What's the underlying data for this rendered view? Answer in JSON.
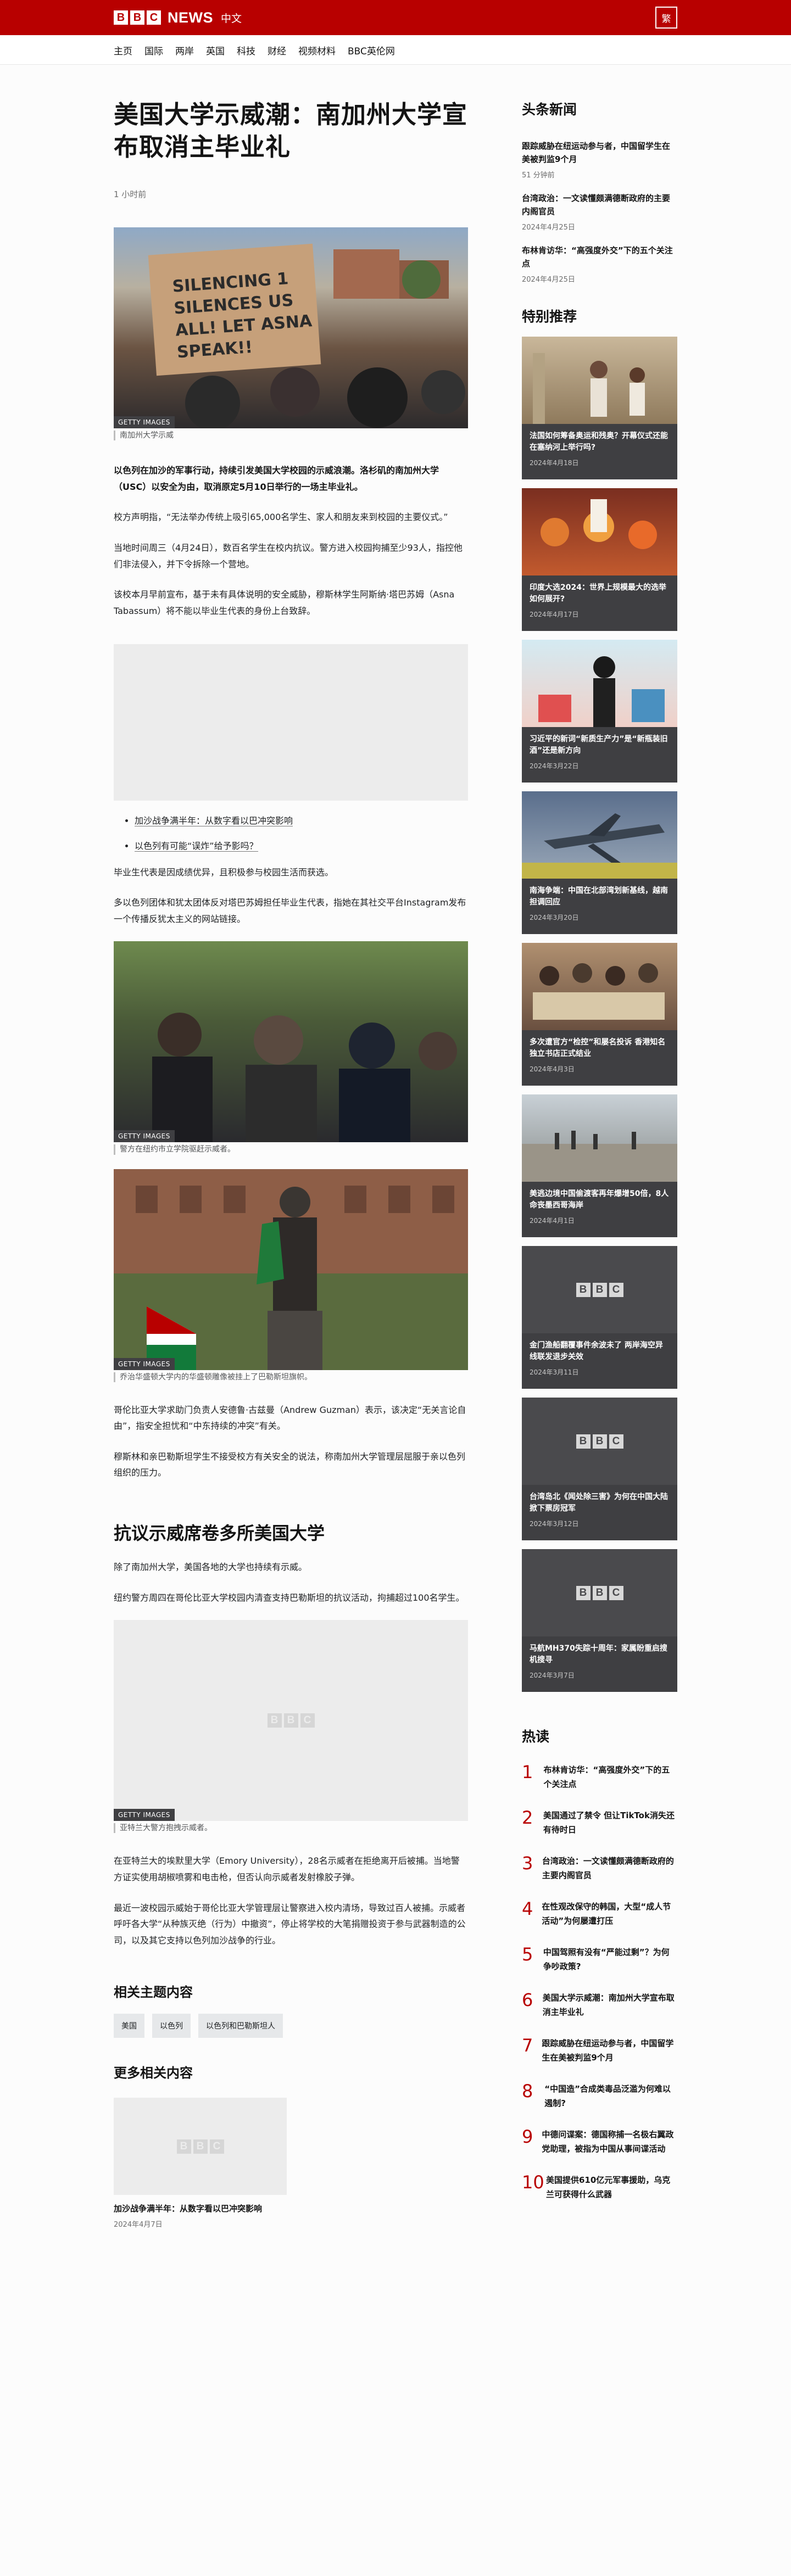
{
  "header": {
    "logo_letters": [
      "B",
      "B",
      "C"
    ],
    "news": "NEWS",
    "lang": "中文",
    "script_button": "繁"
  },
  "nav": [
    "主页",
    "国际",
    "两岸",
    "英国",
    "科技",
    "财经",
    "视频材料",
    "BBC英伦网"
  ],
  "article": {
    "title": "美国大学示威潮：南加州大学宣布取消主毕业礼",
    "time": "1 小时前",
    "img1_credit": "GETTY IMAGES",
    "img1_caption": "南加州大学示威",
    "img1_sign_text": [
      "SILENCING 1",
      "SILENCES US",
      "ALL! LET ASNA",
      "SPEAK!!"
    ],
    "lead": "以色列在加沙的军事行动，持续引发美国大学校园的示威浪潮。洛杉矶的南加州大学（USC）以安全为由，取消原定5月10日举行的一场主毕业礼。",
    "p1": "校方声明指，“无法举办传统上吸引65,000名学生、家人和朋友来到校园的主要仪式。”",
    "p2": "当地时间周三（4月24日），数百名学生在校内抗议。警方进入校园拘捕至少93人，指控他们非法侵入，并下令拆除一个营地。",
    "p3": "该校本月早前宣布，基于未有具体说明的安全威胁，穆斯林学生阿斯纳·塔巴苏姆（Asna Tabassum）将不能以毕业生代表的身份上台致辞。",
    "links": [
      "加沙战争满半年：从数字看以巴冲突影响",
      "以色列有可能“误炸”给予影吗？"
    ],
    "p4": "毕业生代表是因成绩优异，且积极参与校园生活而获选。",
    "p5": "多以色列团体和犹太团体反对塔巴苏姆担任毕业生代表，指她在其社交平台Instagram发布一个传播反犹太主义的网站链接。",
    "img2_credit": "GETTY IMAGES",
    "img2_caption": "警方在纽约市立学院驱赶示威者。",
    "img3_credit": "GETTY IMAGES",
    "img3_caption": "乔治华盛顿大学内的华盛顿雕像被挂上了巴勒斯坦旗帜。",
    "p6": "哥伦比亚大学求助门负责人安德鲁·古兹曼（Andrew Guzman）表示，该决定“无关言论自由”，指安全担忧和“中东持续的冲突”有关。",
    "p7": "穆斯林和亲巴勒斯坦学生不接受校方有关安全的说法，称南加州大学管理层屈服于亲以色列组织的压力。",
    "section_title": "抗议示威席卷多所美国大学",
    "p8": "除了南加州大学，美国各地的大学也持续有示威。",
    "p9": "纽约警方周四在哥伦比亚大学校园内清查支持巴勒斯坦的抗议活动，拘捕超过100名学生。",
    "img4_credit": "GETTY IMAGES",
    "img4_caption": "亚特兰大警方抱拽示威者。",
    "p10": "在亚特兰大的埃默里大学（Emory University），28名示威者在拒绝离开后被捕。当地警方证实使用胡椒喷雾和电击枪，但否认向示威者发射橡胶子弹。",
    "p11": "最近一波校园示威始于哥伦比亚大学管理层让警察进入校内清场，导致过百人被捕。示威者呼吁各大学“从种族灭绝（行为）中撤资”，停止将学校的大笔捐赠投资于参与武器制造的公司，以及其它支持以色列加沙战争的行业。",
    "related_topics_title": "相关主题内容",
    "tags": [
      "美国",
      "以色列",
      "以色列和巴勒斯坦人"
    ],
    "more_title": "更多相关内容",
    "more_card_title": "加沙战争满半年：从数字看以巴冲突影响",
    "more_card_date": "2024年4月7日"
  },
  "sidebar": {
    "top_title": "头条新闻",
    "top": [
      {
        "title": "跟踪威胁在纽运动参与者，中国留学生在美被判监9个月",
        "date": "51 分钟前"
      },
      {
        "title": "台湾政治：一文读懂颇满德断政府的主要内阁官员",
        "date": "2024年4月25日"
      },
      {
        "title": "布林肯访华：“高强度外交”下的五个关注点",
        "date": "2024年4月25日"
      }
    ],
    "features_title": "特别推荐",
    "features": [
      {
        "title": "法国如何筹备奥运和残奥？开幕仪式还能在塞纳河上举行吗?",
        "date": "2024年4月18日"
      },
      {
        "title": "印度大选2024：世界上规模最大的选举如何展开?",
        "date": "2024年4月17日"
      },
      {
        "title": "习近平的新词“新质生产力”是“新瓶装旧酒”还是新方向",
        "date": "2024年3月22日"
      },
      {
        "title": "南海争端：中国在北部湾划新基线，越南担调回应",
        "date": "2024年3月20日"
      },
      {
        "title": "多次遭官方“检控”和屡名投诉 香港知名独立书店正式结业",
        "date": "2024年4月3日"
      },
      {
        "title": "美逃边境中国偷渡客再年爆增50倍，8人命丧墨西哥海岸",
        "date": "2024年4月1日"
      },
      {
        "title": "金门渔船翻覆事件余波未了 两岸海空异线联发退步关效",
        "date": "2024年3月11日"
      },
      {
        "title": "台湾岛北《闻处除三害》为何在中国大陆掀下票房冠军",
        "date": "2024年3月12日"
      },
      {
        "title": "马航MH370失踪十周年：家属盼重启搜机搜寻",
        "date": "2024年3月7日"
      }
    ],
    "popular_title": "热读",
    "popular": [
      "布林肯访华：“高强度外交”下的五个关注点",
      "美国通过了禁令 但让TikTok消失还有待时日",
      "台湾政治：一文读懂颇满德断政府的主要内阁官员",
      "在性观改保守的韩国，大型“成人节活动”为何屡遭打压",
      "中国驾照有没有“严能过剩”？为何争吵政策?",
      "美国大学示威潮：南加州大学宣布取消主毕业礼",
      "跟踪威胁在纽运动参与者，中国留学生在美被判监9个月",
      "“中国造”合成类毒品泛滥为何难以遏制?",
      "中德问谍案：德国称捕一名极右翼政党助理，被指为中国从事间谍活动",
      "美国提供610亿元军事援助，乌克兰可获得什么武器"
    ],
    "popular_nums": [
      "1",
      "2",
      "3",
      "4",
      "5",
      "6",
      "7",
      "8",
      "9",
      "10"
    ]
  },
  "colors": {
    "brand": "#b80000",
    "promo_bg": "#3f3f42",
    "placeholder": "#ececec"
  }
}
